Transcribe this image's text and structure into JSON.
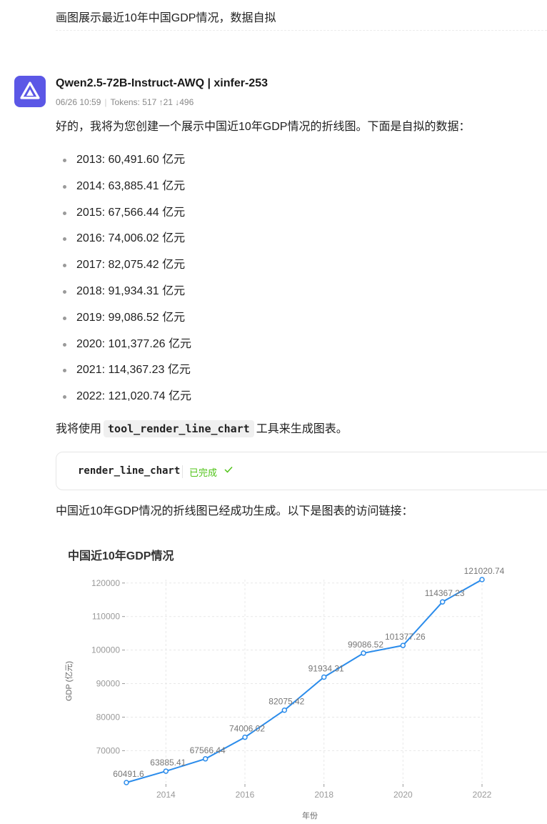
{
  "user_message": "画图展示最近10年中国GDP情况，数据自拟",
  "bot": {
    "name": "Qwen2.5-72B-Instruct-AWQ | xinfer-253",
    "timestamp": "06/26 10:59",
    "tokens": "Tokens: 517 ↑21 ↓496",
    "intro": "好的，我将为您创建一个展示中国近10年GDP情况的折线图。下面是自拟的数据：",
    "list": [
      "2013: 60,491.60 亿元",
      "2014: 63,885.41 亿元",
      "2015: 67,566.44 亿元",
      "2016: 74,006.02 亿元",
      "2017: 82,075.42 亿元",
      "2018: 91,934.31 亿元",
      "2019: 99,086.52 亿元",
      "2020: 101,377.26 亿元",
      "2021: 114,367.23 亿元",
      "2022: 121,020.74 亿元"
    ],
    "tool_sentence_before": "我将使用",
    "tool_code": "tool_render_line_chart",
    "tool_sentence_after": "工具来生成图表。",
    "tool_card": {
      "name": "render_line_chart",
      "status": "已完成"
    },
    "result_text": "中国近10年GDP情况的折线图已经成功生成。以下是图表的访问链接："
  },
  "colors": {
    "accent": "#2b8ceb",
    "avatar": "#5b57e6",
    "status": "#52c41a"
  },
  "chart_data": {
    "type": "line",
    "title": "中国近10年GDP情况",
    "xlabel": "年份",
    "ylabel": "GDP (亿元)",
    "x": [
      2013,
      2014,
      2015,
      2016,
      2017,
      2018,
      2019,
      2020,
      2021,
      2022
    ],
    "values": [
      60491.6,
      63885.41,
      67566.44,
      74006.02,
      82075.42,
      91934.31,
      99086.52,
      101377.26,
      114367.23,
      121020.74
    ],
    "data_labels": [
      "60491.6",
      "63885.41",
      "67566.44",
      "74006.02",
      "82075.42",
      "91934.31",
      "99086.52",
      "101377.26",
      "114367.23",
      "121020.74"
    ],
    "x_ticks": [
      "2014",
      "2016",
      "2018",
      "2020",
      "2022"
    ],
    "y_ticks": [
      "70000",
      "80000",
      "90000",
      "100000",
      "110000",
      "120000"
    ],
    "xlim": [
      2013,
      2022
    ],
    "ylim": [
      60491.6,
      121020.74
    ],
    "grid": true,
    "legend": "none"
  }
}
